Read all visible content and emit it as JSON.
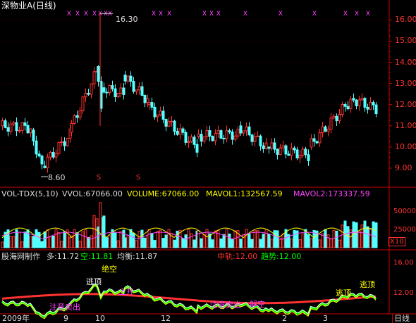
{
  "window": {
    "title": "深物业A(日线)"
  },
  "price_panel": {
    "y_ticks": [
      "16.00",
      "15.00",
      "14.00",
      "13.00",
      "12.00",
      "11.00",
      "10.00",
      "9.00"
    ],
    "high_label": "16.30",
    "low_label": "8.60",
    "signal_marker": "X",
    "s_marker": "S",
    "close_last": "11.83"
  },
  "volume_panel": {
    "header_name": "VOL-TDX(5,10)",
    "vvol": "VVOL:67066.00",
    "volume": "VOLUME:67066.00",
    "mavol1": "MAVOL1:132567.59",
    "mavol2": "MAVOL2:173337.59",
    "y_ticks": [
      "50000",
      "25000"
    ],
    "unit": "X10"
  },
  "indicator_panel": {
    "maker": "股海网制作",
    "duo": "多:11.72",
    "kong": "空:11.81",
    "junheng": "均衡:11.87",
    "zhonggui": "中轨:12.00",
    "qushi": "趋势:12.00",
    "y_ticks": [
      "16.00",
      "12.00"
    ],
    "labels": {
      "jue_kong": "绝空",
      "tao_ding": "逃顶",
      "zhuyi_maichu": "注意卖出",
      "shangsheng": "上升",
      "jie_kong": "解空"
    }
  },
  "time_axis": {
    "labels": [
      "2009年",
      "9",
      "10",
      "12",
      "2",
      "3"
    ],
    "period": "日线"
  },
  "colors": {
    "up": "#ff3232",
    "down": "#54ffff",
    "axis": "#c80000",
    "magenta": "#ff44ff",
    "yellow": "#ffff00",
    "green": "#00ff00"
  }
}
